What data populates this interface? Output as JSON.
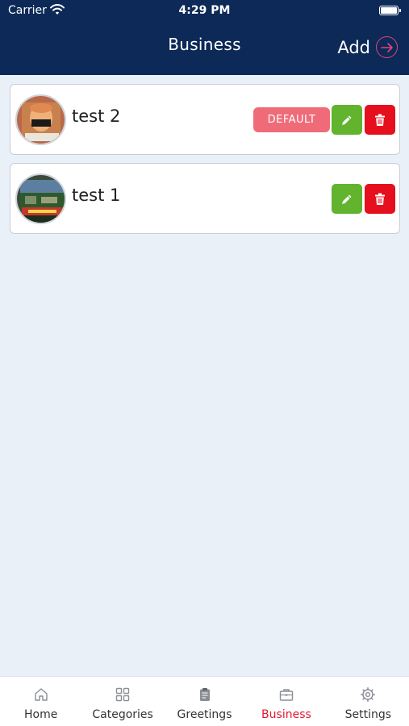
{
  "status_bar": {
    "carrier": "Carrier",
    "time": "4:29 PM"
  },
  "header": {
    "title": "Business",
    "add_label": "Add"
  },
  "businesses": [
    {
      "name": "test 2",
      "is_default": true,
      "default_label": "DEFAULT"
    },
    {
      "name": "test 1",
      "is_default": false
    }
  ],
  "tabs": [
    {
      "label": "Home",
      "icon": "home-icon",
      "active": false
    },
    {
      "label": "Categories",
      "icon": "grid-icon",
      "active": false
    },
    {
      "label": "Greetings",
      "icon": "clipboard-icon",
      "active": false
    },
    {
      "label": "Business",
      "icon": "briefcase-icon",
      "active": true
    },
    {
      "label": "Settings",
      "icon": "gear-icon",
      "active": false
    }
  ],
  "colors": {
    "header_bg": "#0c2957",
    "accent_pink": "#e2457a",
    "default_badge": "#ef6b78",
    "edit_green": "#62b32d",
    "delete_red": "#e60f1e",
    "active_tab": "#e4182e"
  }
}
